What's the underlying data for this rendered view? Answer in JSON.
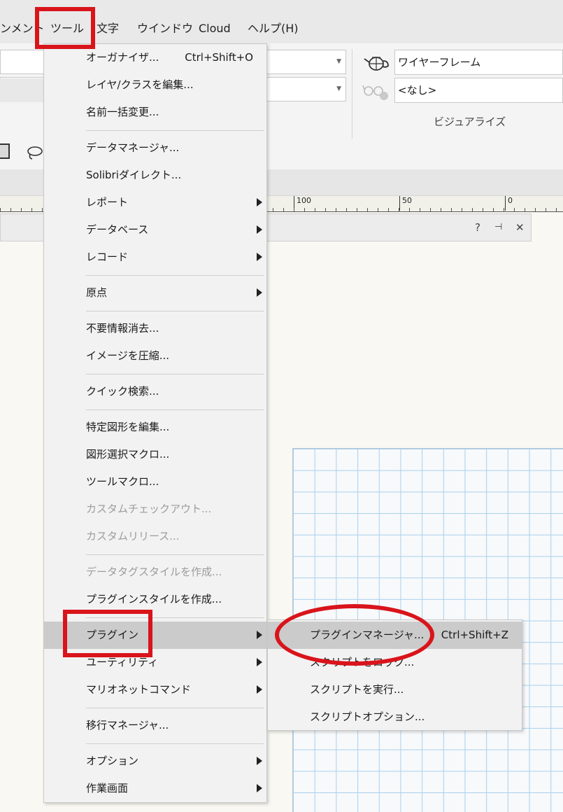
{
  "menubar": {
    "items": [
      "ンメント",
      "ツール",
      "文字",
      "ウインドウ",
      "Cloud",
      "ヘルプ(H)"
    ]
  },
  "ribbon": {
    "render_mode_value": "ワイヤーフレーム",
    "projection_value": "<なし>",
    "group_label": "ビジュアライズ"
  },
  "ruler": {
    "labels": [
      "100",
      "50",
      "0"
    ]
  },
  "palette": {
    "help": "?",
    "pin": "⊣",
    "close": "✕"
  },
  "tools_menu": {
    "items": [
      {
        "label": "オーガナイザ...",
        "shortcut": "Ctrl+Shift+O"
      },
      {
        "label": "レイヤ/クラスを編集..."
      },
      {
        "label": "名前一括変更..."
      },
      {
        "label": "データマネージャ..."
      },
      {
        "label": "Solibriダイレクト..."
      },
      {
        "label": "レポート"
      },
      {
        "label": "データベース"
      },
      {
        "label": "レコード"
      },
      {
        "label": "原点"
      },
      {
        "label": "不要情報消去..."
      },
      {
        "label": "イメージを圧縮..."
      },
      {
        "label": "クイック検索..."
      },
      {
        "label": "特定図形を編集..."
      },
      {
        "label": "図形選択マクロ..."
      },
      {
        "label": "ツールマクロ..."
      },
      {
        "label": "カスタムチェックアウト..."
      },
      {
        "label": "カスタムリリース..."
      },
      {
        "label": "データタグスタイルを作成..."
      },
      {
        "label": "プラグインスタイルを作成..."
      },
      {
        "label": "プラグイン"
      },
      {
        "label": "ユーティリティ"
      },
      {
        "label": "マリオネットコマンド"
      },
      {
        "label": "移行マネージャ..."
      },
      {
        "label": "オプション"
      },
      {
        "label": "作業画面"
      }
    ]
  },
  "plugin_submenu": {
    "items": [
      {
        "label": "プラグインマネージャ...",
        "shortcut": "Ctrl+Shift+Z"
      },
      {
        "label": "スクリプトをロック..."
      },
      {
        "label": "スクリプトを実行..."
      },
      {
        "label": "スクリプトオプション..."
      }
    ]
  },
  "colors": {
    "annotation_red": "#d9141b",
    "menu_highlight": "#cbcbcb",
    "grid_line": "#a9d0ec"
  }
}
